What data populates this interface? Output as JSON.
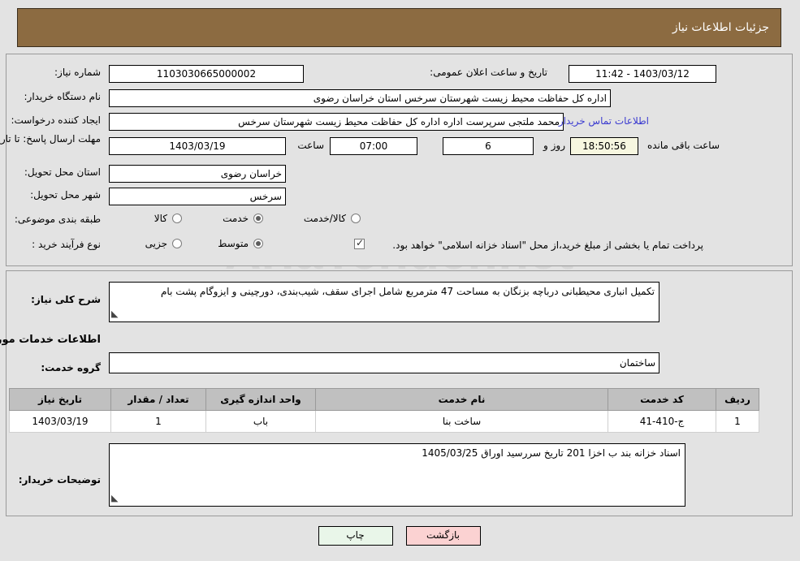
{
  "header": {
    "title": "جزئیات اطلاعات نیاز"
  },
  "watermark": {
    "text": "AriaTender.net"
  },
  "top_section": {
    "need_number_label": "شماره نیاز:",
    "need_number_value": "1103030665000002",
    "announce_datetime_label": "تاریخ و ساعت اعلان عمومی:",
    "announce_datetime_value": "1403/03/12 - 11:42",
    "buyer_org_label": "نام دستگاه خریدار:",
    "buyer_org_value": "اداره کل حفاظت محیط زیست شهرستان سرخس استان خراسان رضوی",
    "creator_label": "ایجاد کننده درخواست:",
    "creator_value": "محمد ملتجی سرپرست اداره اداره کل حفاظت محیط زیست شهرستان سرخس",
    "contact_link": "اطلاعات تماس خریدار",
    "deadline_label": "مهلت ارسال پاسخ: تا تاریخ:",
    "deadline_date": "1403/03/19",
    "hour_label": "ساعت",
    "deadline_time": "07:00",
    "days_remaining": "6",
    "days_label": "روز و",
    "time_remaining": "18:50:56",
    "remaining_suffix": "ساعت باقی مانده",
    "province_label": "استان محل تحویل:",
    "province_value": "خراسان رضوی",
    "city_label": "شهر محل تحویل:",
    "city_value": "سرخس",
    "category_label": "طبقه بندی موضوعی:",
    "category_options": [
      {
        "label": "کالا",
        "selected": false
      },
      {
        "label": "خدمت",
        "selected": true
      },
      {
        "label": "کالا/خدمت",
        "selected": false
      }
    ],
    "process_label": "نوع فرآیند خرید :",
    "process_options": [
      {
        "label": "جزیی",
        "selected": false
      },
      {
        "label": "متوسط",
        "selected": true
      }
    ],
    "treasury_checkbox_checked": true,
    "treasury_note": "پرداخت تمام یا بخشی از مبلغ خرید،از محل \"اسناد خزانه اسلامی\" خواهد بود."
  },
  "mid_section": {
    "summary_label": "شرح کلی نیاز:",
    "summary_value": "تکمیل انباری محیطبانی درباچه بزنگان به مساحت 47 مترمربع شامل اجرای سقف، شیب‌بندی، دورچینی و ایزوگام پشت بام",
    "services_heading": "اطلاعات خدمات مورد نیاز",
    "service_group_label": "گروه خدمت:",
    "service_group_value": "ساختمان",
    "buyer_notes_label": "توضیحات خریدار:",
    "buyer_notes_value": "اسناد خزانه بند ب اخزا 201 تاریخ سررسید اوراق 1405/03/25"
  },
  "table": {
    "columns": [
      "ردیف",
      "کد خدمت",
      "نام خدمت",
      "واحد اندازه گیری",
      "تعداد / مقدار",
      "تاریخ نیاز"
    ],
    "rows": [
      {
        "row_no": "1",
        "service_code": "ج-410-41",
        "service_name": "ساخت بنا",
        "unit": "باب",
        "quantity": "1",
        "need_date": "1403/03/19"
      }
    ]
  },
  "buttons": {
    "print": "چاپ",
    "back": "بازگشت"
  }
}
